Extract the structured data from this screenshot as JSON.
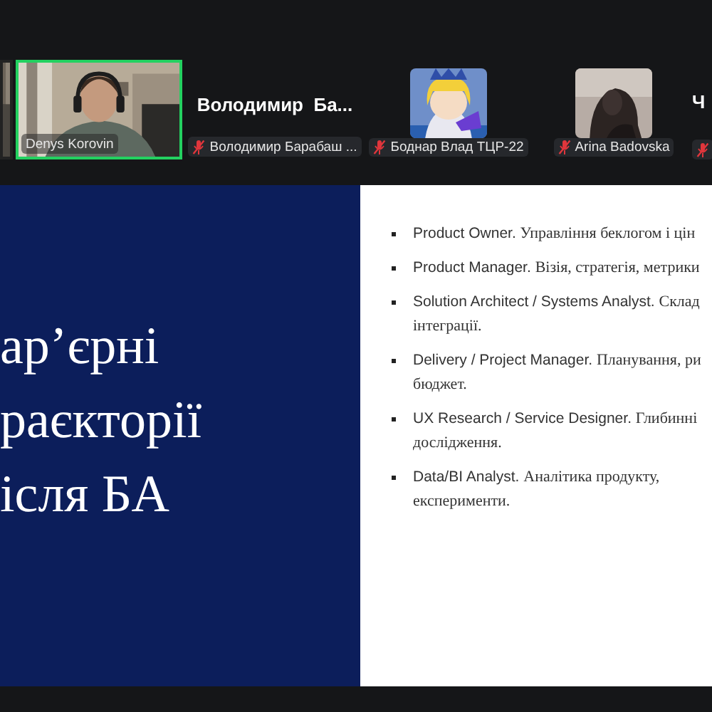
{
  "participants": [
    {
      "kind": "video"
    },
    {
      "kind": "video",
      "name": "Denys Korovin",
      "speaking": true,
      "muted": false
    },
    {
      "kind": "name",
      "display_name": "Володимир  Ба...",
      "name": "Володимир Барабаш ...",
      "speaking": false,
      "muted": true
    },
    {
      "kind": "avatar",
      "name": "Боднар Влад ТЦР-22",
      "speaking": false,
      "muted": true
    },
    {
      "kind": "avatar",
      "name": "Arina Badovska",
      "speaking": false,
      "muted": true
    },
    {
      "kind": "name",
      "display_name": "Ч",
      "speaking": false,
      "muted": true
    }
  ],
  "slide": {
    "title_lines": [
      "ар’єрні",
      "раєкторії",
      "ісля БА"
    ],
    "bullets": [
      {
        "term": "Product Owner.",
        "description": "Управління беклогом і цін"
      },
      {
        "term": "Product Manager.",
        "description": "Візія, стратегія, метрики"
      },
      {
        "term": "Solution Architect / Systems Analyst.",
        "description": "Склад",
        "continuation": "інтеграції."
      },
      {
        "term": "Delivery / Project Manager.",
        "description": "Планування, ри",
        "continuation": "бюджет."
      },
      {
        "term": "UX Research / Service Designer.",
        "description": "Глибинні",
        "continuation": "дослідження."
      },
      {
        "term": "Data/BI Analyst.",
        "description": "Аналітика продукту,",
        "continuation": "експерименти."
      }
    ]
  }
}
